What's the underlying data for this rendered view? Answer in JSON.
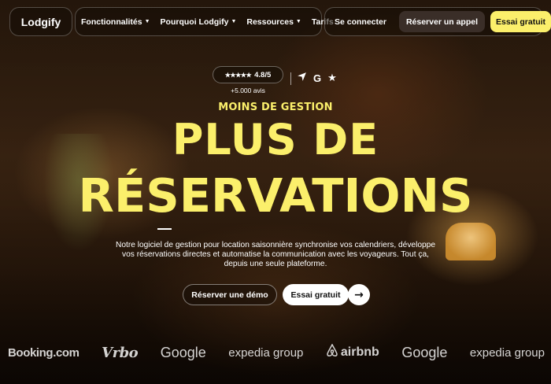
{
  "header": {
    "logo": "Lodgify",
    "nav": [
      {
        "label": "Fonctionnalités",
        "has_dropdown": true
      },
      {
        "label": "Pourquoi Lodgify",
        "has_dropdown": true
      },
      {
        "label": "Ressources",
        "has_dropdown": true
      },
      {
        "label": "Tarifs",
        "has_dropdown": false
      }
    ],
    "login_label": "Se connecter",
    "book_call_label": "Réserver un appel",
    "trial_label": "Essai gratuit"
  },
  "rating": {
    "stars": "★★★★★",
    "score": "4.8/5",
    "reviews": "+5.000 avis",
    "icons": [
      "capterra-arrow-icon",
      "google-icon",
      "star-icon"
    ]
  },
  "hero": {
    "eyebrow": "MOINS DE GESTION",
    "headline_line1": "PLUS DE",
    "headline_line2": "RÉSERVATIONS",
    "description": "Notre logiciel de gestion pour location saisonnière synchronise vos calendriers, développe vos réservations directes et automatise la communication avec les voyageurs. Tout ça, depuis une seule plateforme.",
    "cta_demo": "Réserver une démo",
    "cta_trial": "Essai gratuit",
    "cta_arrow": "→"
  },
  "partners": [
    "Booking.com",
    "Vrbo",
    "Google",
    "expedia group",
    "airbnb",
    "Google",
    "expedia group"
  ],
  "colors": {
    "accent_yellow": "#fbef6b",
    "pill_dark": "#3a2e28"
  }
}
